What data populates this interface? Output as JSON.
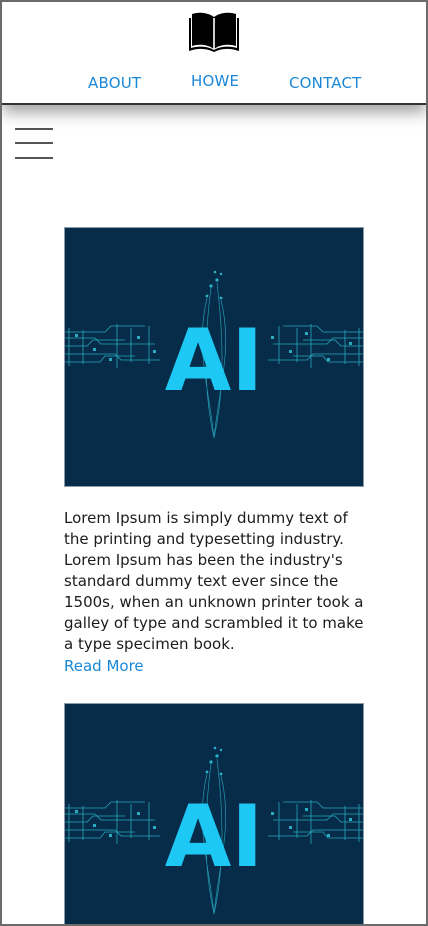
{
  "header": {
    "logo_icon": "open-book-icon",
    "nav": [
      {
        "label": "ABOUT"
      },
      {
        "label": "HOWE"
      },
      {
        "label": "CONTACT"
      }
    ]
  },
  "menu_icon": "hamburger-menu-icon",
  "posts": [
    {
      "image_text": "AI",
      "text": "Lorem Ipsum is simply dummy text of the printing and typesetting industry. Lorem Ipsum has been the industry's standard dummy text ever since the 1500s, when an unknown printer took a galley of type and scrambled it to make a type specimen book.",
      "read_more": "Read More"
    },
    {
      "image_text": "AI"
    }
  ],
  "colors": {
    "link": "#1a87d6",
    "image_background": "#062c49",
    "ai_text": "#1ec8f5",
    "circuit": "#2bb3c9"
  }
}
